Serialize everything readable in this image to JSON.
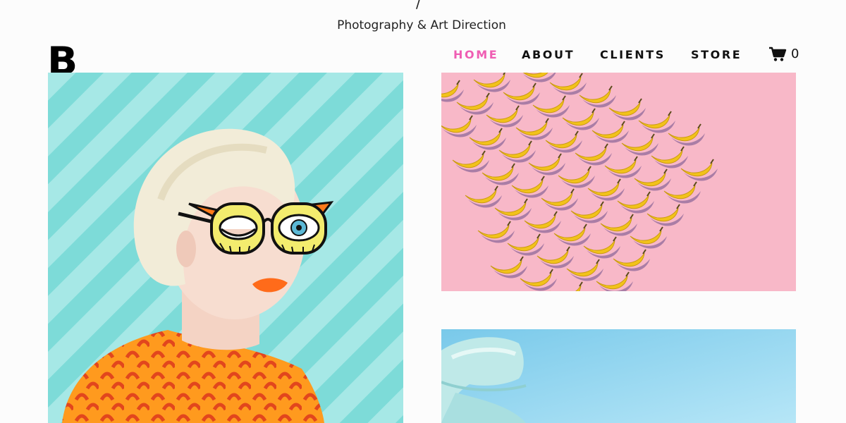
{
  "header": {
    "slash": "/",
    "tagline": "Photography & Art Direction",
    "logo": "B"
  },
  "nav": {
    "items": [
      {
        "label": "HOME",
        "active": true
      },
      {
        "label": "ABOUT",
        "active": false
      },
      {
        "label": "CLIENTS",
        "active": false
      },
      {
        "label": "STORE",
        "active": false
      }
    ],
    "active_color": "#ef5db3",
    "text_color": "#111111"
  },
  "cart": {
    "icon": "cart-icon",
    "count": "0"
  },
  "gallery": {
    "tiles": [
      {
        "name": "portrait-glasses",
        "bg_color": "#7ddbd8",
        "accent": "#ff7a1a"
      },
      {
        "name": "banana-pattern",
        "bg_color": "#f8b8c8",
        "accent": "#f2c21b"
      },
      {
        "name": "blue-glass",
        "bg_color": "#8fd3ef",
        "accent": "#bfe9e8"
      }
    ]
  }
}
